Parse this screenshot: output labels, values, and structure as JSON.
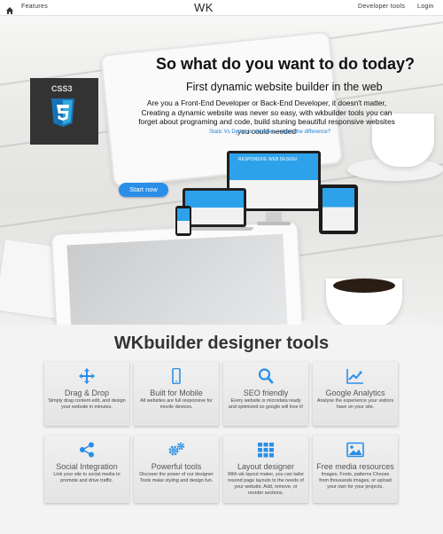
{
  "nav": {
    "home_icon": "home-icon",
    "features": "Features",
    "brand": "WK",
    "developer_tools": "Developer tools",
    "login": "Login"
  },
  "hero": {
    "title": "So what do you want to do today?",
    "subtitle": "First dynamic website builder in the web",
    "description": "Are you a Front-End Developer or Back-End Developer, it doesn't matter, Creating a dynamic website was never so easy, with wkbuilder tools you can forget about programing and code, build stuning beautiful responsive websites you could needed",
    "link": "Static Vs Dynamic websites - what's the difference?",
    "start_button": "Start now",
    "badge_label": "CSS3",
    "monitor_text": "RESPONSIVE WEB DESIGN"
  },
  "tools": {
    "title": "WKbuilder designer tools",
    "cards": [
      {
        "icon": "move-arrows-icon",
        "title": "Drag & Drop",
        "desc": "Simply drag content edit, and design your website in minutes."
      },
      {
        "icon": "mobile-icon",
        "title": "Built for Mobile",
        "desc": "All websites are full responsive for movile devices."
      },
      {
        "icon": "search-icon",
        "title": "SEO friendly",
        "desc": "Every website is microdata ready and optimized so google will love it!"
      },
      {
        "icon": "line-chart-icon",
        "title": "Google Analytics",
        "desc": "Analyse the experience your visitors have on your site."
      },
      {
        "icon": "share-icon",
        "title": "Social Integration",
        "desc": "Link your site to social media to promote and drive traffic."
      },
      {
        "icon": "gears-icon",
        "title": "Powerful tools",
        "desc": "Discover the power of our designer Tools make styling and design fun."
      },
      {
        "icon": "grid-layout-icon",
        "title": "Layout designer",
        "desc": "With wk layout maker, you can tailor resond page layouts to the needs of your website. Add, remove, or reorder sections."
      },
      {
        "icon": "image-icon",
        "title": "Free media resources",
        "desc": "Images, Fonts, patterns Choose from thousands images, or upload your own for your projects."
      }
    ]
  },
  "colors": {
    "accent": "#2a8fe8",
    "link": "#1b7fd1",
    "icon_blue": "#2a8fe8"
  }
}
